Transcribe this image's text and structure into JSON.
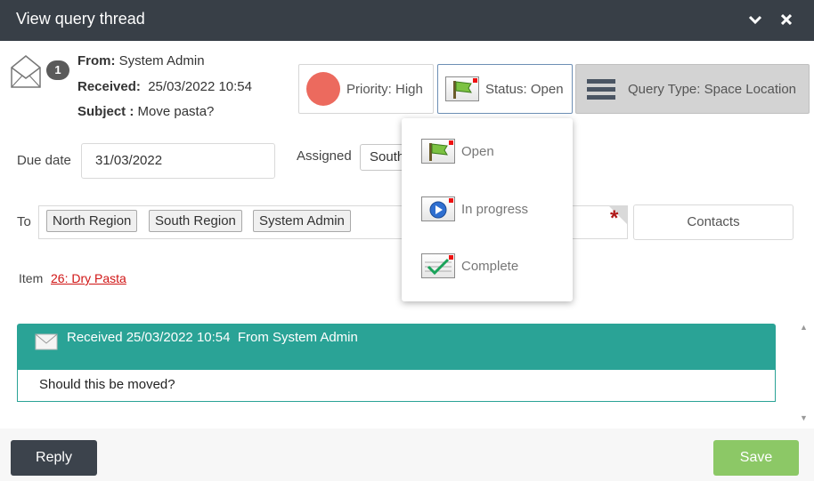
{
  "window": {
    "title": "View query thread"
  },
  "message": {
    "count": "1",
    "from_label": "From:",
    "from_value": "System Admin",
    "received_label": "Received:",
    "received_value": "25/03/2022 10:54",
    "subject_label": "Subject :",
    "subject_value": "Move pasta?"
  },
  "chips": {
    "priority": "Priority: High",
    "status": "Status: Open",
    "query_type": "Query Type: Space Location"
  },
  "form": {
    "due_date_label": "Due date",
    "due_date_value": "31/03/2022",
    "assigned_label": "Assigned",
    "assigned_value": "South",
    "to_label": "To",
    "recipients": [
      "North Region",
      "South Region",
      "System Admin"
    ],
    "required_mark": "*",
    "contacts_label": "Contacts",
    "item_label": "Item",
    "item_link": "26: Dry Pasta"
  },
  "status_menu": {
    "items": [
      {
        "label": "Open",
        "icon": "flag-icon"
      },
      {
        "label": "In progress",
        "icon": "play-icon"
      },
      {
        "label": "Complete",
        "icon": "check-icon"
      }
    ]
  },
  "thread": [
    {
      "header": "Received 25/03/2022 10:54  From System Admin",
      "body": "Should this be moved?"
    }
  ],
  "footer": {
    "reply_label": "Reply",
    "save_label": "Save"
  },
  "colors": {
    "titlebar": "#383f47",
    "teal": "#2aa396",
    "priority_high": "#ec6a5e",
    "save_green": "#8cc866",
    "link_red": "#d01515"
  }
}
